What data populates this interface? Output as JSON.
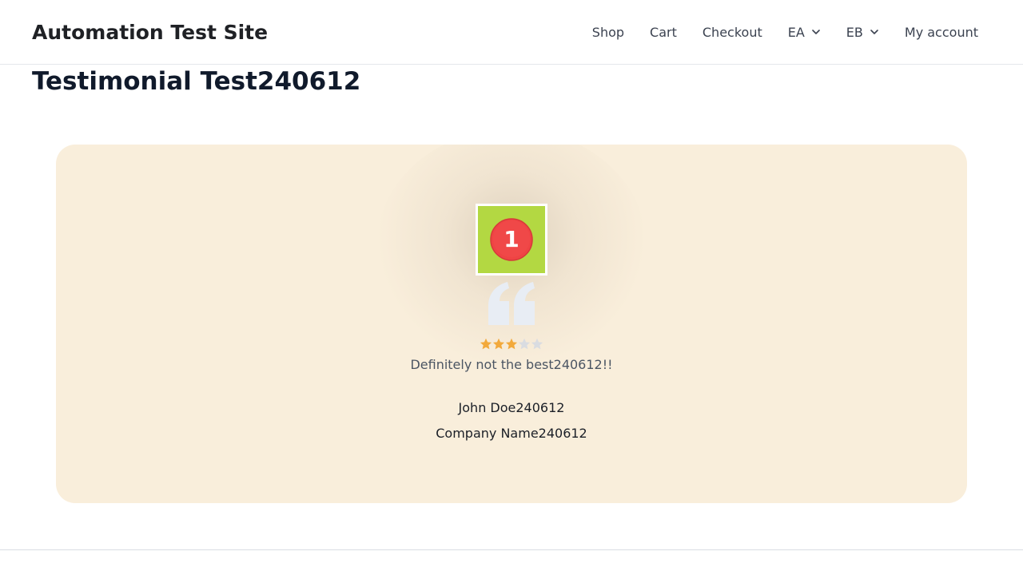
{
  "header": {
    "site_title": "Automation Test Site",
    "nav": [
      {
        "label": "Shop",
        "has_dropdown": false
      },
      {
        "label": "Cart",
        "has_dropdown": false
      },
      {
        "label": "Checkout",
        "has_dropdown": false
      },
      {
        "label": "EA",
        "has_dropdown": true
      },
      {
        "label": "EB",
        "has_dropdown": true
      },
      {
        "label": "My account",
        "has_dropdown": false
      }
    ]
  },
  "page": {
    "title": "Testimonial Test240612"
  },
  "testimonial": {
    "avatar_badge": "1",
    "rating": 3,
    "rating_max": 5,
    "text": "Definitely not the best240612!!",
    "author_name": "John Doe240612",
    "author_company": "Company Name240612"
  },
  "colors": {
    "card_background": "#f9eedb",
    "avatar_background": "#b3d842",
    "badge_red": "#ef4444",
    "star_filled": "#f2a93b",
    "star_empty": "#d9dce1",
    "quote_icon": "#e8edf4"
  },
  "icons": {
    "quote": "quote-icon",
    "star": "star-icon",
    "dropdown": "chevron-down-icon"
  }
}
